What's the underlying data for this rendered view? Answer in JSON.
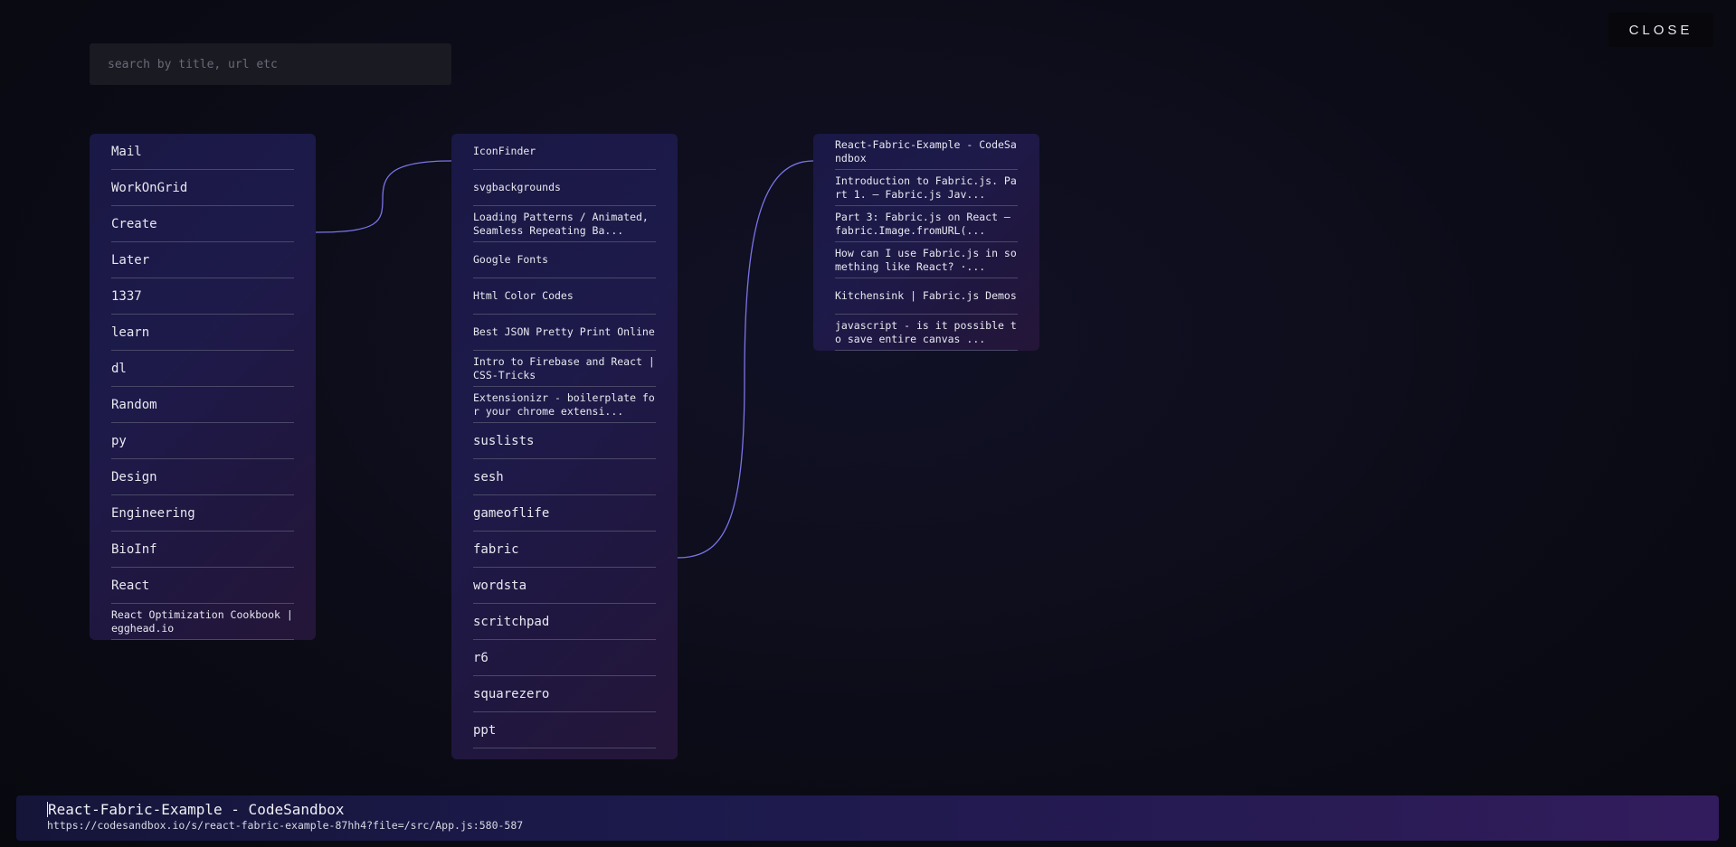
{
  "close_label": "CLOSE",
  "search": {
    "placeholder": "search by title, url etc",
    "value": ""
  },
  "columns": [
    {
      "items": [
        {
          "label": "Mail"
        },
        {
          "label": "WorkOnGrid"
        },
        {
          "label": "Create",
          "selected": true
        },
        {
          "label": "Later"
        },
        {
          "label": "1337"
        },
        {
          "label": "learn"
        },
        {
          "label": "dl"
        },
        {
          "label": "Random"
        },
        {
          "label": "py"
        },
        {
          "label": "Design"
        },
        {
          "label": "Engineering"
        },
        {
          "label": "BioInf"
        },
        {
          "label": "React"
        },
        {
          "label": "React Optimization Cookbook | egghead.io",
          "small": true
        }
      ]
    },
    {
      "items": [
        {
          "label": "IconFinder",
          "small": true
        },
        {
          "label": "svgbackgrounds",
          "small": true
        },
        {
          "label": "Loading Patterns / Animated, Seamless Repeating Ba...",
          "small": true
        },
        {
          "label": "Google Fonts",
          "small": true
        },
        {
          "label": "Html Color Codes",
          "small": true
        },
        {
          "label": "Best JSON Pretty Print Online",
          "small": true
        },
        {
          "label": "Intro to Firebase and React | CSS-Tricks",
          "small": true
        },
        {
          "label": "Extensionizr - boilerplate for your chrome extensi...",
          "small": true
        },
        {
          "label": "suslists"
        },
        {
          "label": "sesh"
        },
        {
          "label": "gameoflife"
        },
        {
          "label": "fabric",
          "selected": true
        },
        {
          "label": "wordsta"
        },
        {
          "label": "scritchpad"
        },
        {
          "label": "r6"
        },
        {
          "label": "squarezero"
        },
        {
          "label": "ppt"
        }
      ]
    },
    {
      "items": [
        {
          "label": "React-Fabric-Example - CodeSandbox",
          "small": true
        },
        {
          "label": "Introduction to Fabric.js. Part 1. — Fabric.js Jav...",
          "small": true
        },
        {
          "label": "Part 3: Fabric.js on React — fabric.Image.fromURL(...",
          "small": true
        },
        {
          "label": "How can I use Fabric.js in something like React? ·...",
          "small": true
        },
        {
          "label": "Kitchensink | Fabric.js Demos",
          "small": true
        },
        {
          "label": "javascript - is it possible to save entire canvas ...",
          "small": true
        }
      ]
    }
  ],
  "footer": {
    "title": "React-Fabric-Example - CodeSandbox",
    "url": "https://codesandbox.io/s/react-fabric-example-87hh4?file=/src/App.js:580-587"
  },
  "colors": {
    "link_curve": "#7b74e6",
    "panel": "#1c1a48",
    "divider": "#4a4868"
  }
}
